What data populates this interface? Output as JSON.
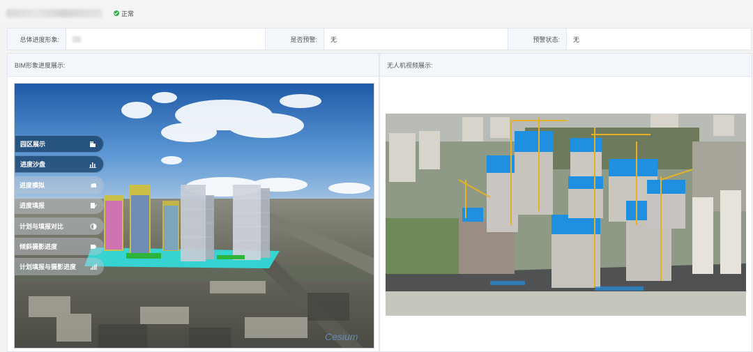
{
  "header": {
    "status_text": "正常",
    "status_color": "#3aae4a",
    "status_icon": "check-circle-icon"
  },
  "info_row": [
    {
      "label": "总体进度形象:",
      "value": ""
    },
    {
      "label": "是否预警:",
      "value": "无"
    },
    {
      "label": "预警状态:",
      "value": "无"
    }
  ],
  "bim_panel": {
    "title": "BIM形象进度展示:"
  },
  "drone_panel": {
    "title": "无人机视频展示:"
  },
  "menu": [
    {
      "label": "园区展示",
      "icon": "building-icon",
      "state": "active"
    },
    {
      "label": "进度沙盘",
      "icon": "bar-chart-icon",
      "state": "active"
    },
    {
      "label": "进度模拟",
      "icon": "cloud-icon",
      "state": "dim"
    },
    {
      "label": "进度填报",
      "icon": "edit-icon",
      "state": "dim"
    },
    {
      "label": "计划与填报对比",
      "icon": "half-circle-icon",
      "state": "dim"
    },
    {
      "label": "倾斜摄影进度",
      "icon": "tag-icon",
      "state": "dim"
    },
    {
      "label": "计划填报与摄影进度",
      "icon": "ascending-bars-icon",
      "state": "dim"
    }
  ]
}
